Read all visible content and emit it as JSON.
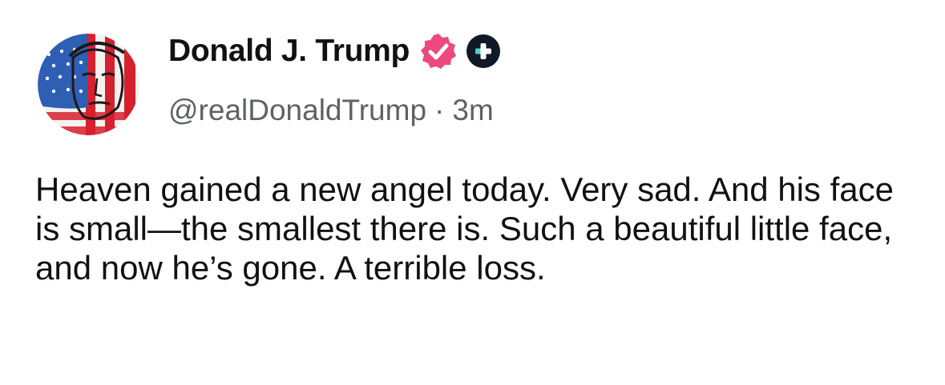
{
  "author": {
    "display_name": "Donald J. Trump",
    "handle": "@realDonaldTrump",
    "separator": "·",
    "timestamp": "3m",
    "verified_icon": "verified-badge-icon",
    "membership_icon": "plus-badge-icon"
  },
  "post": {
    "text": "Heaven gained a new angel today. Very sad. And his face is small—the smallest there is. Such a beautiful little face, and now he’s gone. A terrible loss."
  },
  "colors": {
    "verified_badge": "#ea4a7d",
    "plus_badge": "#111827",
    "plus_accent": "#4fd1c5",
    "secondary_text": "#5e6166"
  }
}
